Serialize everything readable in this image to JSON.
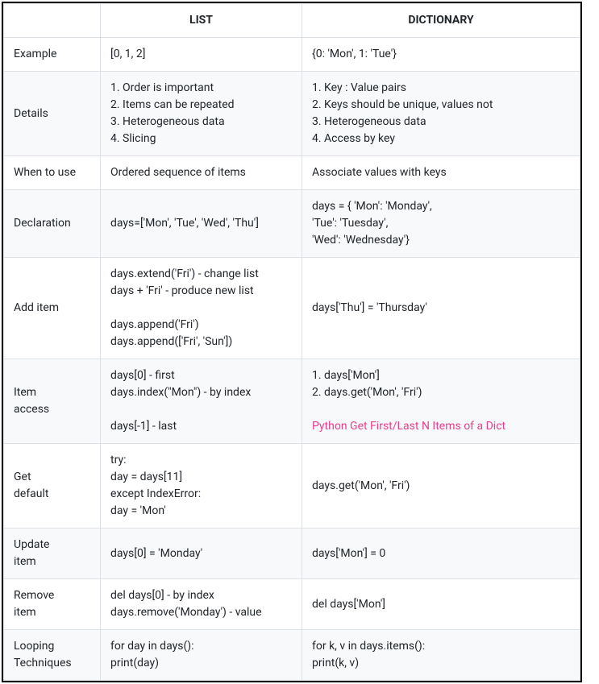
{
  "headers": {
    "col0": "",
    "col1": "LIST",
    "col2": "DICTIONARY"
  },
  "rows": [
    {
      "label": "Example",
      "list": "[0, 1, 2]",
      "dict": "{0: 'Mon', 1: 'Tue'}"
    },
    {
      "label": "Details",
      "list": "1. Order is important\n2. Items can be repeated\n3. Heterogeneous data\n4. Slicing",
      "dict": "1. Key : Value pairs\n2. Keys should be unique, values not\n3. Heterogeneous data\n4. Access by key"
    },
    {
      "label": "When to use",
      "list": "Ordered sequence of items",
      "dict": "Associate values with keys"
    },
    {
      "label": "Declaration",
      "list": "days=['Mon', 'Tue', 'Wed', 'Thu']",
      "dict": "days = { 'Mon': 'Monday',\n'Tue': 'Tuesday',\n'Wed': 'Wednesday'}"
    },
    {
      "label": "Add item",
      "list": "days.extend('Fri') - change list\ndays + 'Fri' - produce new list\n\ndays.append('Fri')\ndays.append(['Fri', 'Sun'])",
      "dict": "days['Thu'] = 'Thursday'"
    },
    {
      "label": "Item\naccess",
      "list": "days[0] - first\ndays.index(\"Mon\") - by index\n\ndays[-1] - last",
      "dict_prefix": "1. days['Mon']\n2. days.get('Mon', 'Fri')\n\n",
      "dict_link": "Python Get First/Last N Items of a Dict"
    },
    {
      "label": "Get\ndefault",
      "list": "try:\nday = days[11]\nexcept IndexError:\nday = 'Mon'",
      "dict": "days.get('Mon', 'Fri')"
    },
    {
      "label": "Update\nitem",
      "list": "days[0] = 'Monday'",
      "dict": "days['Mon'] = 0"
    },
    {
      "label": "Remove\nitem",
      "list": "del days[0] - by index\ndays.remove('Monday') - value",
      "dict": "del days['Mon']"
    },
    {
      "label": "Looping\nTechniques",
      "list": "for day in days():\nprint(day)",
      "dict": "for k, v in days.items():\nprint(k, v)"
    }
  ]
}
